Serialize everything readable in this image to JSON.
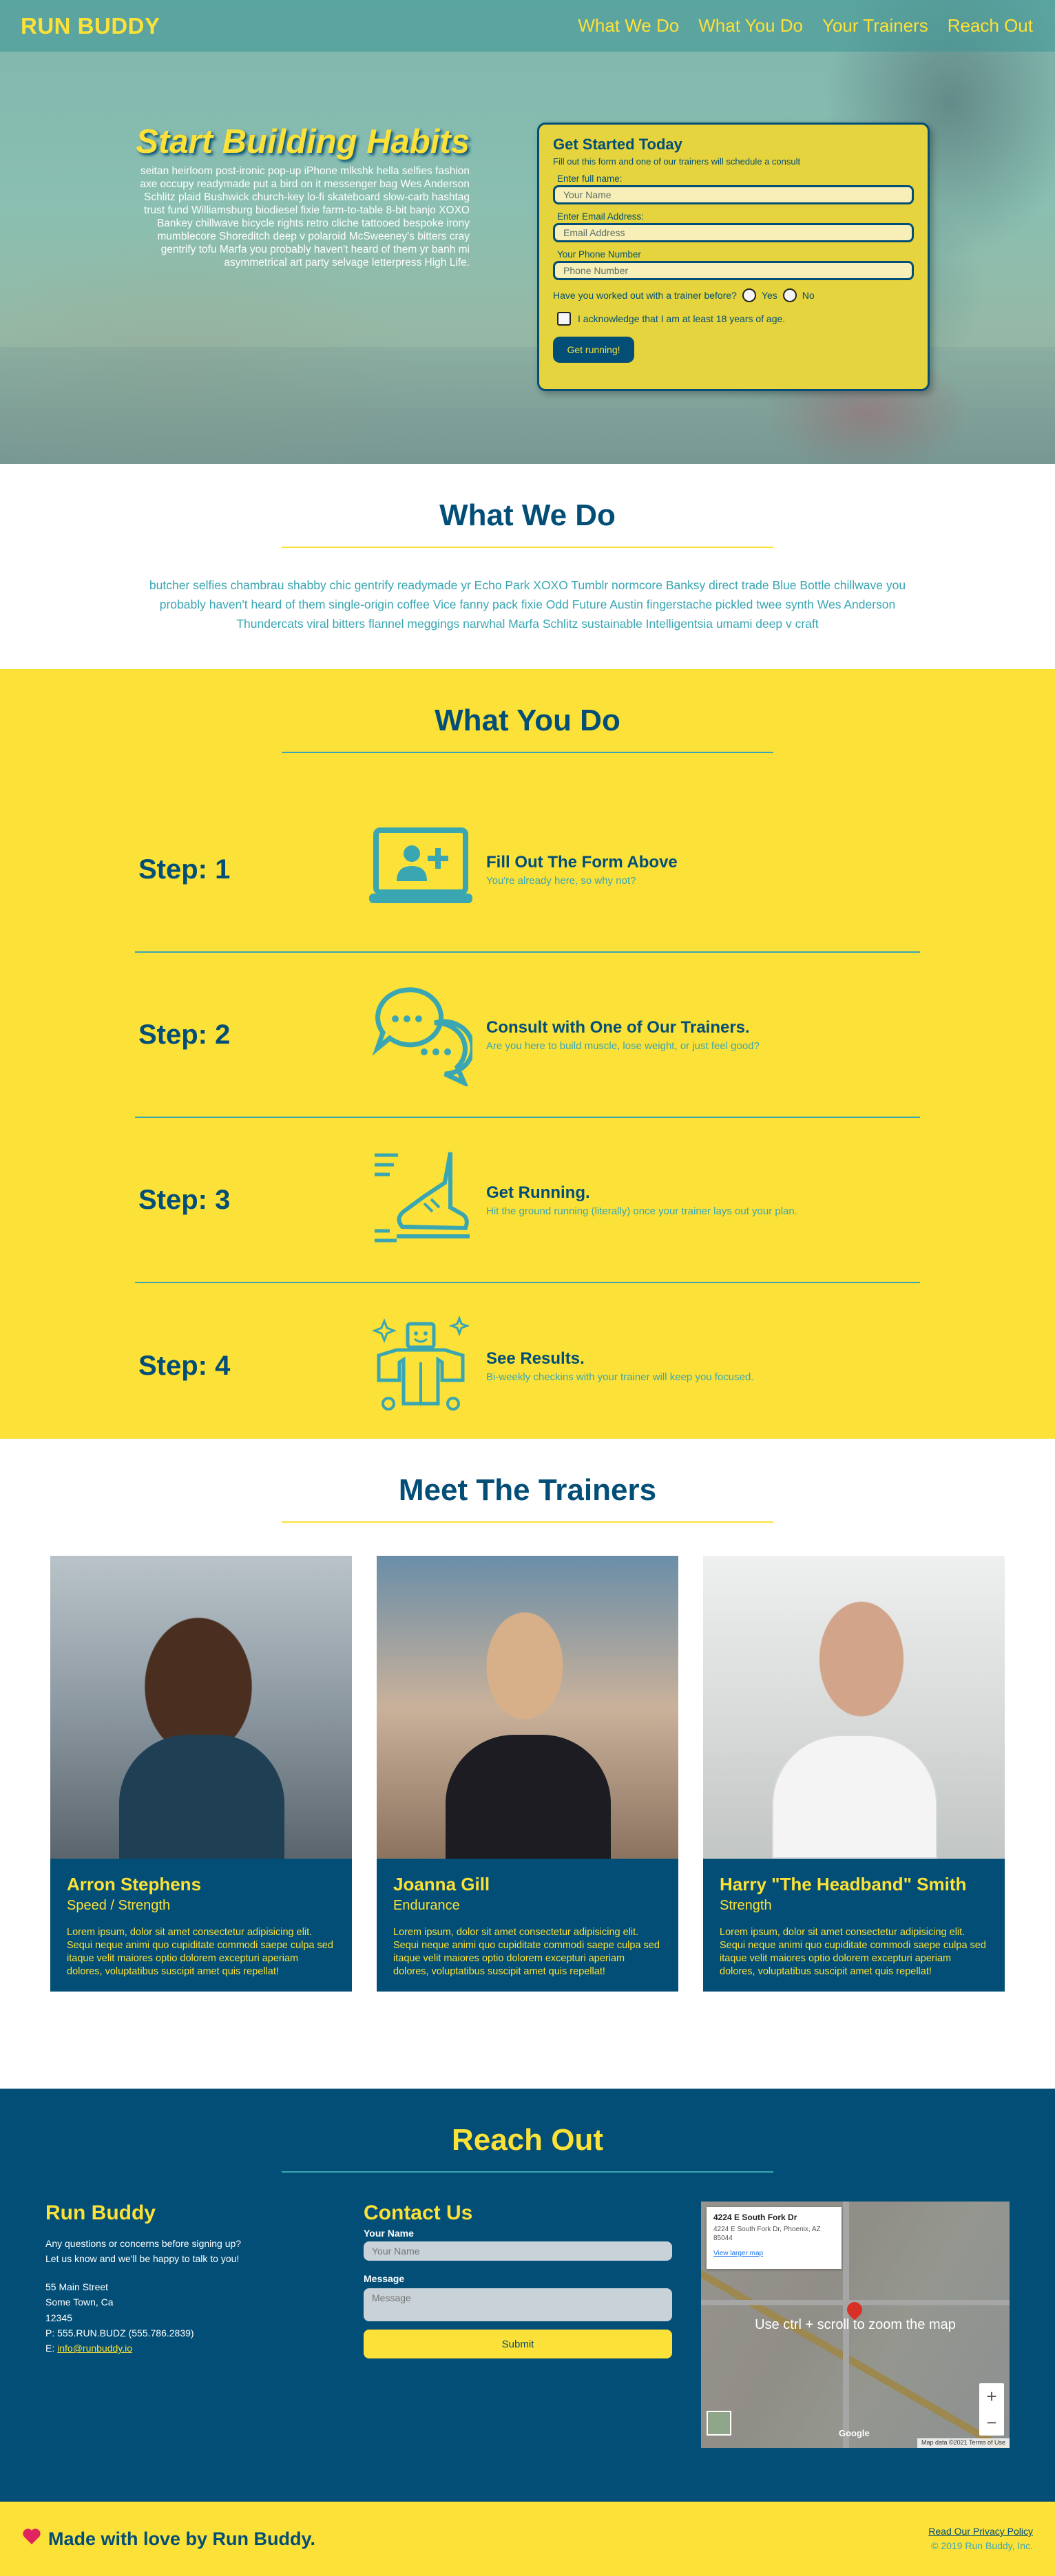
{
  "header": {
    "brand": "RUN BUDDY",
    "nav": [
      "What We Do",
      "What You Do",
      "Your Trainers",
      "Reach Out"
    ]
  },
  "hero": {
    "title": "Start Building Habits",
    "text": "seitan heirloom post-ironic pop-up iPhone mlkshk hella selfies fashion axe occupy readymade put a bird on it messenger bag Wes Anderson Schlitz plaid Bushwick church-key lo-fi skateboard slow-carb hashtag trust fund Williamsburg biodiesel fixie farm-to-table 8-bit banjo XOXO Bankey chillwave bicycle rights retro cliche tattooed bespoke irony mumblecore Shoreditch deep v polaroid McSweeney's bitters cray gentrify tofu Marfa you probably haven't heard of them yr banh mi asymmetrical art party selvage letterpress High Life."
  },
  "signup_form": {
    "title": "Get Started Today",
    "subtitle": "Fill out this form and one of our trainers will schedule a consult",
    "name_label": "Enter full name:",
    "name_placeholder": "Your Name",
    "email_label": "Enter Email Address:",
    "email_placeholder": "Email Address",
    "phone_label": "Your Phone Number",
    "phone_placeholder": "Phone Number",
    "radio_question": "Have you worked out with a trainer before?",
    "radio_yes": "Yes",
    "radio_no": "No",
    "checkbox_label": "I acknowledge that I am at least 18 years of age.",
    "submit_label": "Get running!"
  },
  "what_we_do": {
    "title": "What We Do",
    "text": "butcher selfies chambrau shabby chic gentrify readymade yr Echo Park XOXO Tumblr normcore Banksy direct trade Blue Bottle chillwave you probably haven't heard of them single-origin coffee Vice fanny pack fixie Odd Future Austin fingerstache pickled twee synth Wes Anderson Thundercats viral bitters flannel meggings narwhal Marfa Schlitz sustainable Intelligentsia umami deep v craft"
  },
  "what_you_do": {
    "title": "What You Do",
    "steps": [
      {
        "label": "Step: 1",
        "icon": "laptop-user-icon",
        "heading": "Fill Out The Form Above",
        "desc": "You're already here, so why not?"
      },
      {
        "label": "Step: 2",
        "icon": "chat-bubbles-icon",
        "heading": "Consult with One of Our Trainers.",
        "desc": "Are you here to build muscle, lose weight, or just feel good?"
      },
      {
        "label": "Step: 3",
        "icon": "running-shoe-icon",
        "heading": "Get Running.",
        "desc": "Hit the ground running (literally) once your trainer lays out your plan."
      },
      {
        "label": "Step: 4",
        "icon": "strong-robot-icon",
        "heading": "See Results.",
        "desc": "Bi-weekly checkins with your trainer will keep you focused."
      }
    ]
  },
  "trainers": {
    "title": "Meet The Trainers",
    "list": [
      {
        "name": "Arron Stephens",
        "specialty": "Speed / Strength",
        "bio": "Lorem ipsum, dolor sit amet consectetur adipisicing elit. Sequi neque animi quo cupiditate commodi saepe culpa sed itaque velit maiores optio dolorem excepturi aperiam dolores, voluptatibus suscipit amet quis repellat!"
      },
      {
        "name": "Joanna Gill",
        "specialty": "Endurance",
        "bio": "Lorem ipsum, dolor sit amet consectetur adipisicing elit. Sequi neque animi quo cupiditate commodi saepe culpa sed itaque velit maiores optio dolorem excepturi aperiam dolores, voluptatibus suscipit amet quis repellat!"
      },
      {
        "name": "Harry \"The Headband\" Smith",
        "specialty": "Strength",
        "bio": "Lorem ipsum, dolor sit amet consectetur adipisicing elit. Sequi neque animi quo cupiditate commodi saepe culpa sed itaque velit maiores optio dolorem excepturi aperiam dolores, voluptatibus suscipit amet quis repellat!"
      }
    ]
  },
  "reach_out": {
    "title": "Reach Out",
    "info_title": "Run Buddy",
    "info_line1": "Any questions or concerns before signing up?",
    "info_line2": "Let us know and we'll be happy to talk to you!",
    "address1": "55 Main Street",
    "address2": "Some Town, Ca",
    "zip": "12345",
    "phone": "P: 555.RUN.BUDZ (555.786.2839)",
    "email_prefix": "E: ",
    "email": "info@runbuddy.io",
    "form_title": "Contact Us",
    "name_label": "Your Name",
    "name_placeholder": "Your Name",
    "message_label": "Message",
    "message_placeholder": "Message",
    "submit_label": "Submit",
    "map": {
      "card_title": "4224 E South Fork Dr",
      "card_addr": "4224 E South Fork Dr, Phoenix, AZ 85044",
      "card_link": "View larger map",
      "overlay": "Use ctrl + scroll to zoom the map",
      "logo": "Google",
      "zoom_in": "+",
      "zoom_out": "−",
      "footer": "Map data ©2021   Terms of Use"
    }
  },
  "footer": {
    "tagline": "Made with love by Run Buddy.",
    "privacy_link": "Read Our Privacy Policy",
    "copyright": "© 2019 Run Buddy, Inc."
  }
}
